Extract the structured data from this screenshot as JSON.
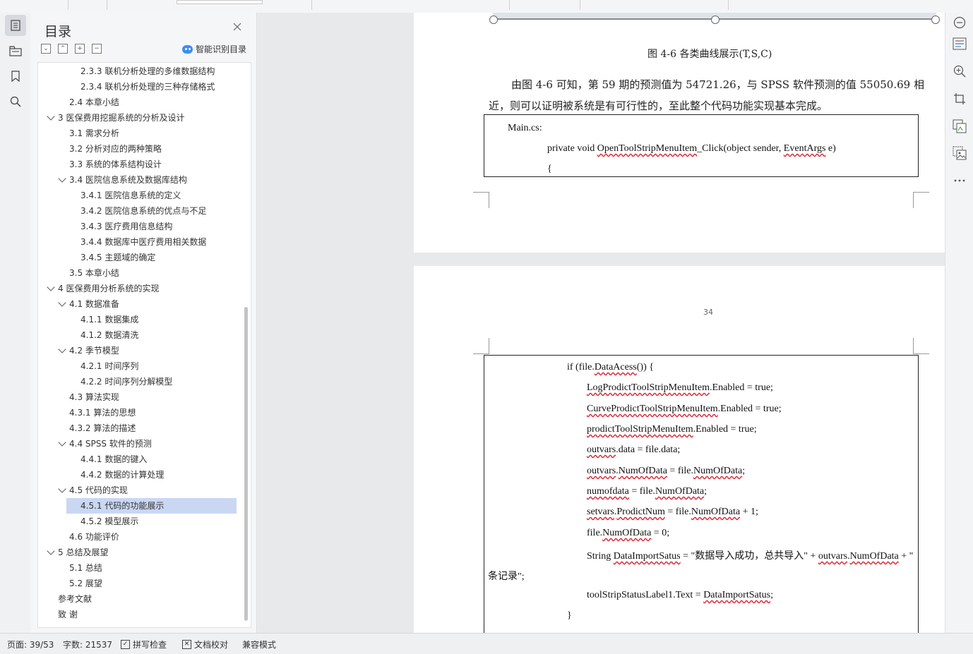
{
  "panel": {
    "title": "目录",
    "smart_label": "智能识别目录",
    "toc": [
      {
        "label": "2.3.3  联机分析处理的多维数据结构",
        "level": 3,
        "chevron": false
      },
      {
        "label": "2.3.4  联机分析处理的三种存储格式",
        "level": 3,
        "chevron": false
      },
      {
        "label": "2.4  本章小结",
        "level": 2,
        "chevron": false
      },
      {
        "label": "3  医保费用挖掘系统的分析及设计",
        "level": 1,
        "chevron": true
      },
      {
        "label": "3.1  需求分析",
        "level": 2,
        "chevron": false
      },
      {
        "label": "3.2 分析对应的两种策略",
        "level": 2,
        "chevron": false
      },
      {
        "label": "3.3  系统的体系结构设计",
        "level": 2,
        "chevron": false
      },
      {
        "label": "3.4 医院信息系统及数据库结构",
        "level": 2,
        "chevron": true
      },
      {
        "label": "3.4.1 医院信息系统的定义",
        "level": 3,
        "chevron": false
      },
      {
        "label": "3.4.2 医院信息系统的优点与不足",
        "level": 3,
        "chevron": false
      },
      {
        "label": "3.4.3 医疗费用信息结构",
        "level": 3,
        "chevron": false
      },
      {
        "label": "3.4.4  数据库中医疗费用相关数据",
        "level": 3,
        "chevron": false
      },
      {
        "label": "3.4.5 主题域的确定",
        "level": 3,
        "chevron": false
      },
      {
        "label": "3.5   本章小结",
        "level": 2,
        "chevron": false
      },
      {
        "label": "4  医保费用分析系统的实现",
        "level": 1,
        "chevron": true
      },
      {
        "label": "4.1  数据准备",
        "level": 2,
        "chevron": true
      },
      {
        "label": "4.1.1  数据集成",
        "level": 3,
        "chevron": false
      },
      {
        "label": "4.1.2  数据清洗",
        "level": 3,
        "chevron": false
      },
      {
        "label": "4.2 季节模型",
        "level": 2,
        "chevron": true
      },
      {
        "label": "4.2.1 时间序列",
        "level": 3,
        "chevron": false
      },
      {
        "label": "4.2.2  时间序列分解模型",
        "level": 3,
        "chevron": false
      },
      {
        "label": "4.3 算法实现",
        "level": 2,
        "chevron": false
      },
      {
        "label": "4.3.1 算法的思想",
        "level": 2,
        "chevron": false
      },
      {
        "label": "4.3.2 算法的描述",
        "level": 2,
        "chevron": false
      },
      {
        "label": "4.4 SPSS 软件的预测",
        "level": 2,
        "chevron": true
      },
      {
        "label": "4.4.1  数据的键入",
        "level": 3,
        "chevron": false
      },
      {
        "label": "4.4.2 数据的计算处理",
        "level": 3,
        "chevron": false
      },
      {
        "label": "4.5  代码的实现",
        "level": 2,
        "chevron": true
      },
      {
        "label": "4.5.1 代码的功能展示",
        "level": 3,
        "chevron": false,
        "selected": true
      },
      {
        "label": "4.5.2  模型展示",
        "level": 3,
        "chevron": false
      },
      {
        "label": "4.6 功能评价",
        "level": 2,
        "chevron": false
      },
      {
        "label": "5  总结及展望",
        "level": 1,
        "chevron": true
      },
      {
        "label": "5.1 总结",
        "level": 2,
        "chevron": false
      },
      {
        "label": "5.2  展望",
        "level": 2,
        "chevron": false
      },
      {
        "label": "参考文献",
        "level": 0,
        "chevron": false
      },
      {
        "label": "致  谢",
        "level": 0,
        "chevron": false
      }
    ]
  },
  "doc": {
    "caption": "图 4-6  各类曲线展示(T,S,C)",
    "para_line1": "由图 4-6 可知，第 59 期的预测值为 54721.26，与 SPSS 软件预测的值 55050.69 相",
    "para_line2": "近，则可以证明被系统是有可行性的，至此整个代码功能实现基本完成。",
    "code1": {
      "line1": "Main.cs:",
      "line2_a": "private void ",
      "line2_b": "OpenToolStripMenuItem",
      "line2_c": "_Click(object sender, ",
      "line2_d": "EventArgs",
      "line2_e": " e)",
      "line3": "{"
    },
    "page_number": "34",
    "code2": {
      "l1_a": "if (file.",
      "l1_b": "DataAcess",
      "l1_c": "()) {",
      "l2_a": "LogProdictToolStripMenuItem",
      "l2_b": ".Enabled = true;",
      "l3_a": "CurveProdictToolStripMenuItem",
      "l3_b": ".Enabled = true;",
      "l4_a": "prodictToolStripMenuItem",
      "l4_b": ".Enabled = true;",
      "l5_a": "outvars",
      "l5_b": ".data = file.data;",
      "l6_a": "outvars",
      "l6_b": ".",
      "l6_c": "NumOfData",
      "l6_d": " = file.",
      "l6_e": "NumOfData",
      "l6_f": ";",
      "l7_a": "numofdata",
      "l7_b": " = file.",
      "l7_c": "NumOfData",
      "l7_d": ";",
      "l8_a": "setvars",
      "l8_b": ".",
      "l8_c": "ProdictNum",
      "l8_d": " = file.",
      "l8_e": "NumOfData",
      "l8_f": " + 1;",
      "l9_a": "file.",
      "l9_b": "NumOfData",
      "l9_c": " = 0;",
      "l10_a": "String ",
      "l10_b": "DataImportSatus",
      "l10_c": " = \"数据导入成功，总共导入\" + ",
      "l10_d": "outvars",
      "l10_e": ".",
      "l10_f": "NumOfData",
      "l10_g": " + \"",
      "l11": "条记录\";",
      "l12_a": "toolStripStatusLabel1.Text = ",
      "l12_b": "DataImportSatus",
      "l12_c": ";",
      "l13": "}"
    }
  },
  "status": {
    "page": "页面: 39/53",
    "words": "字数: 21537",
    "spell": "拼写检查",
    "proof": "文档校对",
    "compat": "兼容模式"
  }
}
